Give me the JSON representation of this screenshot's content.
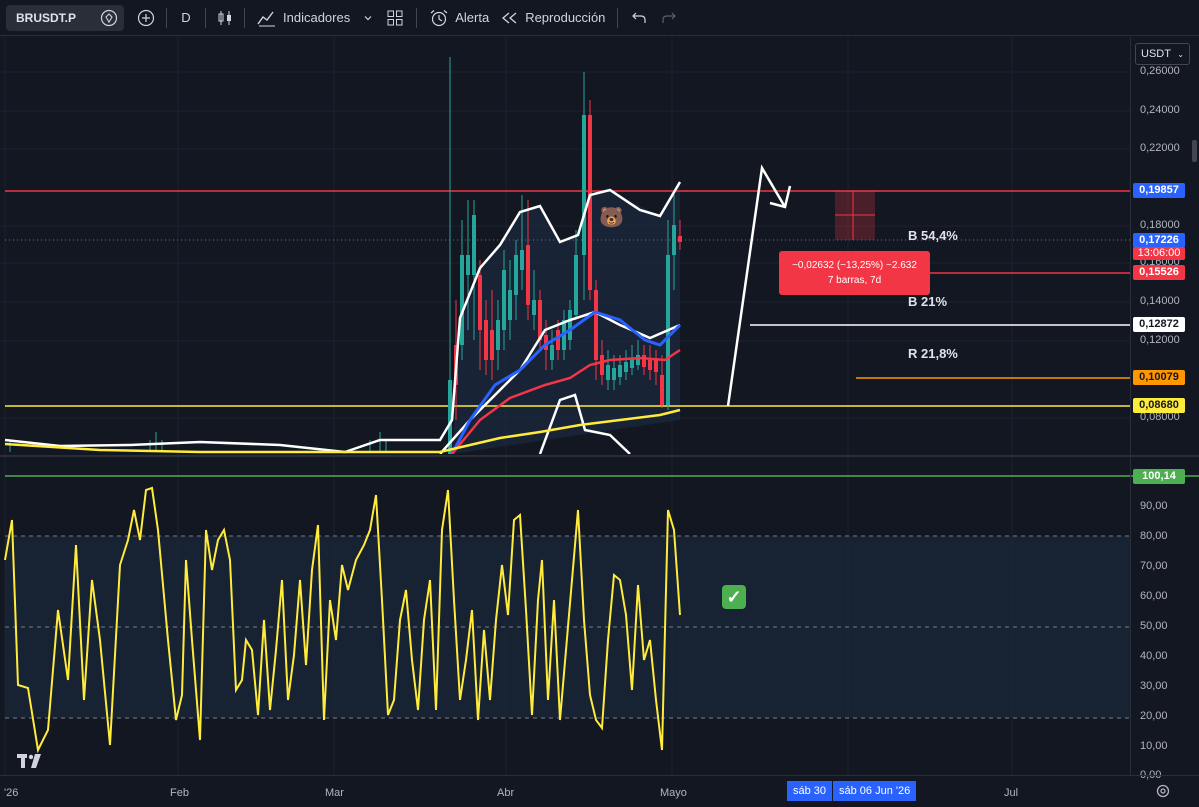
{
  "toolbar": {
    "symbol": "BRUSDT.P",
    "interval": "D",
    "indicators": "Indicadores",
    "alert": "Alerta",
    "replay": "Reproducción"
  },
  "price_axis": {
    "currency": "USDT",
    "ticks": [
      "0,26000",
      "0,24000",
      "0,22000",
      "0,18000",
      "0,16000",
      "0,14000",
      "0,12000",
      "0,08000"
    ],
    "tags": {
      "level_red": "0,19857",
      "last_price": "0,17226",
      "countdown": "13:06:00",
      "pink_level": "0,15526",
      "white_level": "0,12872",
      "orange_level": "0,10079",
      "yellow_level": "0,08680"
    }
  },
  "oscillator_axis": {
    "ticks": [
      "90,00",
      "80,00",
      "70,00",
      "60,00",
      "50,00",
      "40,00",
      "30,00",
      "20,00",
      "10,00",
      "0,00"
    ],
    "level_tag": "100,14"
  },
  "time_axis": {
    "labels": [
      "'26",
      "Feb",
      "Mar",
      "Abr",
      "Mayo",
      "Jul"
    ],
    "cursor_tags": [
      "sáb 30",
      "sáb 06 Jun '26"
    ]
  },
  "annotations": {
    "r1": "B 54,4%",
    "r2": "B 21%",
    "r3": "R 21,8%",
    "measure_line1": "−0,02632 (−13,25%) −2.632",
    "measure_line2": "7 barras, 7d"
  },
  "logo": "TV",
  "colors": {
    "background": "#131722",
    "red": "#f23645",
    "blue": "#2962ff",
    "yellow": "#ffeb3b",
    "white": "#ffffff",
    "orange": "#ff9800",
    "green": "#4caf50",
    "teal": "#26a69a"
  }
}
